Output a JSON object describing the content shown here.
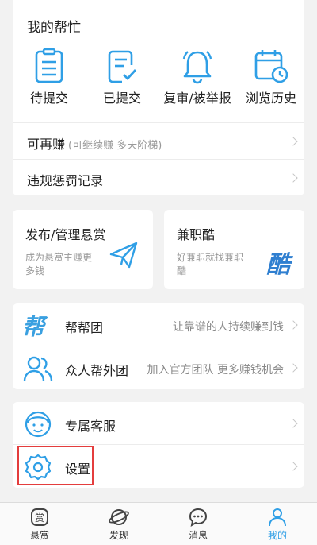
{
  "help": {
    "title": "我的帮忙",
    "items": [
      {
        "label": "待提交",
        "icon": "clipboard-list-icon"
      },
      {
        "label": "已提交",
        "icon": "clipboard-check-icon"
      },
      {
        "label": "复审/被举报",
        "icon": "bell-icon"
      },
      {
        "label": "浏览历史",
        "icon": "calendar-clock-icon"
      }
    ]
  },
  "rows": {
    "earn_title": "可再赚",
    "earn_sub": "(可继续赚 多天阶梯)",
    "penalty_title": "违规惩罚记录"
  },
  "promo": {
    "left_title": "发布/管理悬赏",
    "left_sub": "成为悬赏主赚更多钱",
    "left_icon": "paper-plane-icon",
    "right_title": "兼职酷",
    "right_sub": "好兼职就找兼职酷",
    "right_logo": "酷"
  },
  "groups": {
    "bbt_title": "帮帮团",
    "bbt_text": "让靠谱的人持续赚到钱",
    "bbt_logo": "帮",
    "external_title": "众人帮外团",
    "external_text": "加入官方团队 更多赚钱机会"
  },
  "service": {
    "support_title": "专属客服",
    "settings_title": "设置"
  },
  "nav": {
    "items": [
      {
        "label": "悬赏",
        "icon": "reward-icon",
        "active": false
      },
      {
        "label": "发现",
        "icon": "planet-icon",
        "active": false
      },
      {
        "label": "消息",
        "icon": "chat-icon",
        "active": false
      },
      {
        "label": "我的",
        "icon": "person-icon",
        "active": true
      }
    ]
  },
  "colors": {
    "accent": "#2f9fe6",
    "highlight": "#e43d3d"
  }
}
